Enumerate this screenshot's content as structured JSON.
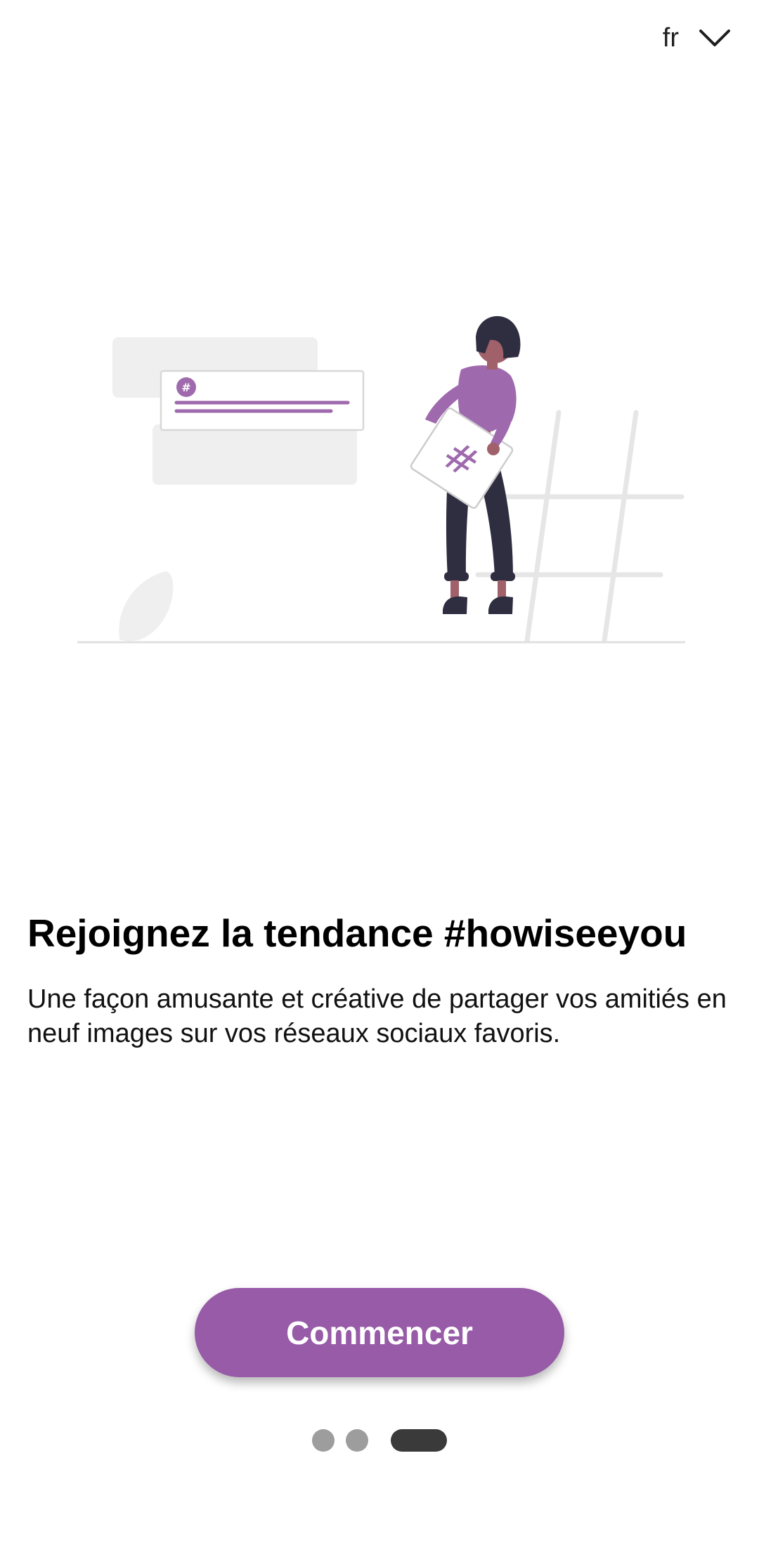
{
  "language_selector": {
    "value": "fr",
    "icon": "chevron-down-icon"
  },
  "onboarding": {
    "title": "Rejoignez la tendance #howiseeyou",
    "description": "Une façon amusante et créative de partager vos amitiés en neuf images sur vos réseaux sociaux favoris.",
    "illustration_icon": "hashtag-icon"
  },
  "actions": {
    "start_label": "Commencer"
  },
  "pager": {
    "total_pages": 3,
    "current_page": 3
  },
  "colors": {
    "accent": "#975ba7",
    "accent_light": "#9f6aad",
    "text_primary": "#000000",
    "dot_inactive": "#9d9d9d",
    "dot_active": "#3a3a3a",
    "illustration_gray": "#efefef",
    "illustration_dark": "#2f2e41",
    "skin": "#a0616a"
  }
}
